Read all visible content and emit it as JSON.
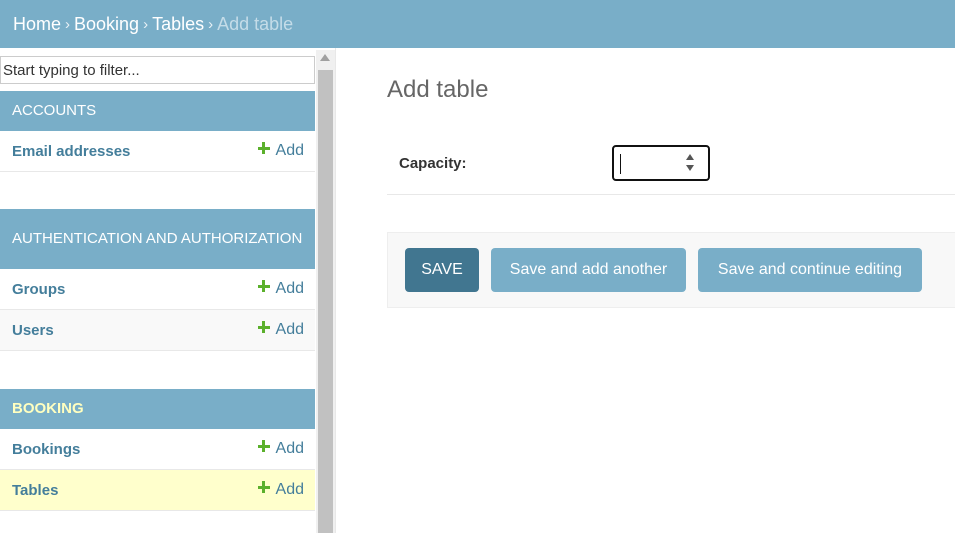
{
  "breadcrumbs": {
    "items": [
      "Home",
      "Booking",
      "Tables"
    ],
    "current": "Add table",
    "separator": "›"
  },
  "sidebar": {
    "filter_placeholder": "Start typing to filter...",
    "modules": [
      {
        "title": "Accounts",
        "active": false,
        "models": [
          {
            "name": "Email addresses",
            "add_label": "Add",
            "selected": false
          }
        ]
      },
      {
        "title": "Authentication and Authorization",
        "active": false,
        "models": [
          {
            "name": "Groups",
            "add_label": "Add",
            "selected": false
          },
          {
            "name": "Users",
            "add_label": "Add",
            "selected": false
          }
        ]
      },
      {
        "title": "Booking",
        "active": true,
        "models": [
          {
            "name": "Bookings",
            "add_label": "Add",
            "selected": false
          },
          {
            "name": "Tables",
            "add_label": "Add",
            "selected": true
          }
        ]
      }
    ]
  },
  "main": {
    "title": "Add table",
    "fields": [
      {
        "label": "Capacity:",
        "value": ""
      }
    ],
    "buttons": {
      "save": "SAVE",
      "save_add_another": "Save and add another",
      "save_continue": "Save and continue editing"
    }
  },
  "colors": {
    "header_bg": "#79aec8",
    "link": "#447e9b",
    "add_icon": "#5bb02c",
    "selected_row": "#ffffcc",
    "active_module_text": "#ffffc0",
    "primary_button": "#417690"
  },
  "icons": {
    "add": "plus-icon"
  }
}
